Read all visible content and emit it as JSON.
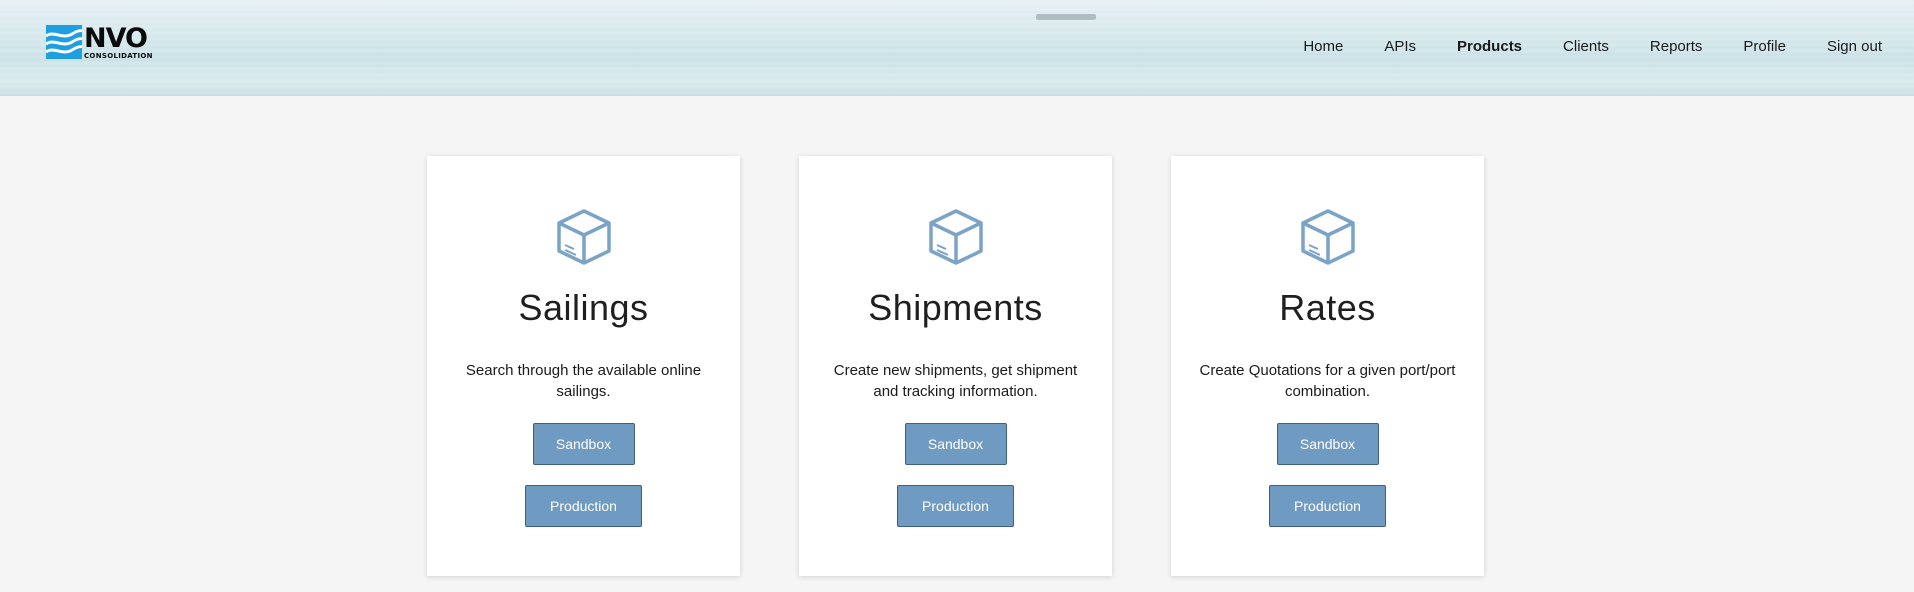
{
  "logo": {
    "main": "NVO",
    "sub": "CONSOLIDATION"
  },
  "nav": {
    "items": [
      {
        "label": "Home"
      },
      {
        "label": "APIs"
      },
      {
        "label": "Products",
        "active": true
      },
      {
        "label": "Clients"
      },
      {
        "label": "Reports"
      },
      {
        "label": "Profile"
      },
      {
        "label": "Sign out"
      }
    ]
  },
  "products": [
    {
      "icon": "box-icon",
      "title": "Sailings",
      "description": "Search through the available online sailings.",
      "sandbox_label": "Sandbox",
      "production_label": "Production"
    },
    {
      "icon": "box-icon",
      "title": "Shipments",
      "description": "Create new shipments, get shipment and tracking information.",
      "sandbox_label": "Sandbox",
      "production_label": "Production"
    },
    {
      "icon": "box-icon",
      "title": "Rates",
      "description": "Create Quotations for a given port/port combination.",
      "sandbox_label": "Sandbox",
      "production_label": "Production"
    }
  ],
  "colors": {
    "accent": "#6f9bc2",
    "icon": "#7aa3c8",
    "logo_blue": "#1ea0e0"
  }
}
